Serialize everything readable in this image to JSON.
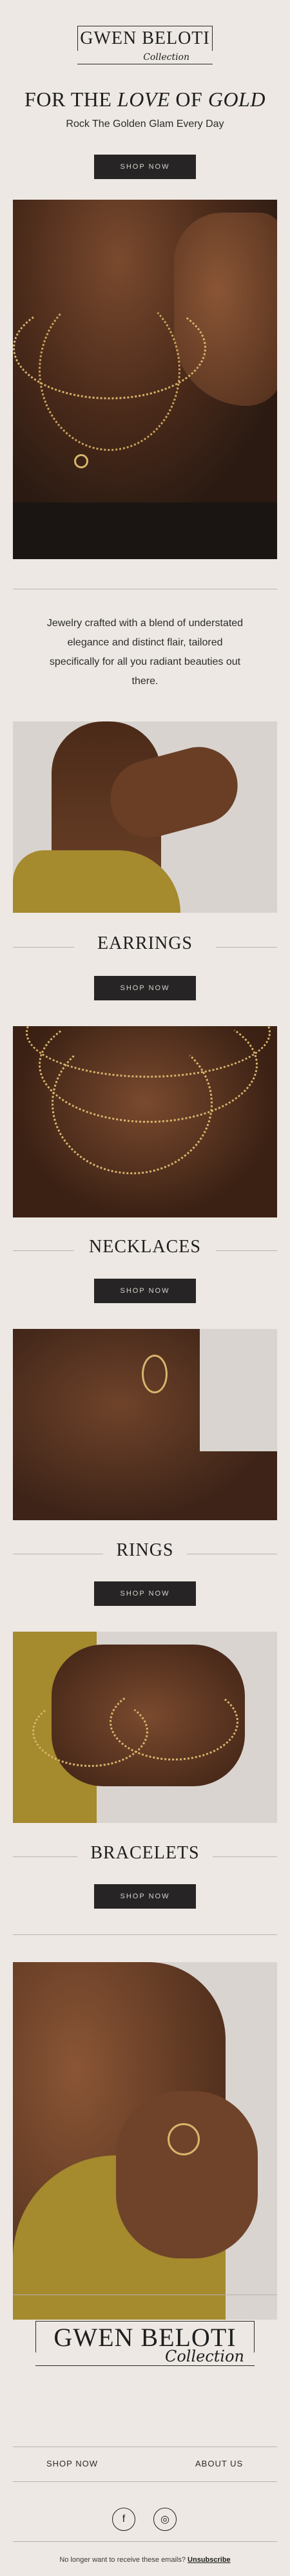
{
  "brand": {
    "name": "GWEN BELOTI",
    "script": "Collection"
  },
  "hero": {
    "title_pre": "FOR THE",
    "title_em1": "LOVE",
    "title_mid": "OF",
    "title_em2": "GOLD",
    "subtitle": "Rock The Golden Glam Every Day",
    "button": "SHOP NOW"
  },
  "intro": "Jewelry crafted with a blend of understated elegance and distinct flair, tailored specifically for all you radiant beauties out there.",
  "categories": [
    {
      "title": "EARRINGS",
      "button": "SHOP NOW"
    },
    {
      "title": "NECKLACES",
      "button": "SHOP NOW"
    },
    {
      "title": "RINGS",
      "button": "SHOP NOW"
    },
    {
      "title": "BRACELETS",
      "button": "SHOP NOW"
    }
  ],
  "footer": {
    "links": [
      "SHOP NOW",
      "ABOUT US"
    ],
    "social": [
      {
        "icon": "facebook-icon",
        "glyph": "f"
      },
      {
        "icon": "instagram-icon",
        "glyph": "◎"
      }
    ],
    "unsub_text": "No longer want to receive these emails?",
    "unsub_link": "Unsubscribe"
  },
  "colors": {
    "background": "#ede8e3",
    "button": "#262424",
    "gold": "#d9b56c"
  }
}
